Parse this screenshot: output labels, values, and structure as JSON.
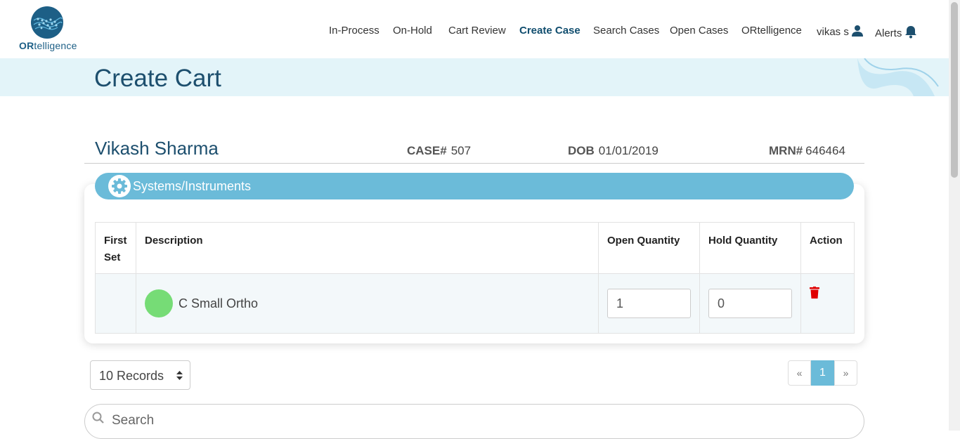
{
  "app": {
    "logo_text_bold": "OR",
    "logo_text_rest": "telligence"
  },
  "nav": {
    "items": [
      {
        "label": "In-Process"
      },
      {
        "label": "On-Hold"
      },
      {
        "label": "Cart Review"
      },
      {
        "label": "Create Case"
      },
      {
        "label": "Search Cases"
      },
      {
        "label": "Open Cases"
      },
      {
        "label": "ORtelligence"
      },
      {
        "label": "vikas s"
      },
      {
        "label": "Alerts"
      }
    ],
    "active": "Create Case"
  },
  "banner": {
    "title": "Create Cart"
  },
  "patient": {
    "name": "Vikash Sharma",
    "case_label": "CASE#",
    "case_value": "507",
    "dob_label": "DOB",
    "dob_value": "01/01/2019",
    "mrn_label": "MRN#",
    "mrn_value": "646464"
  },
  "section": {
    "title": "Systems/Instruments",
    "icon": "gear-icon"
  },
  "table": {
    "headers": {
      "first_set_line1": "First",
      "first_set_line2": "Set",
      "description": "Description",
      "open_quantity": "Open Quantity",
      "hold_quantity": "Hold Quantity",
      "action": "Action"
    },
    "rows": [
      {
        "first_set": "",
        "description": "C Small Ortho",
        "status_color": "#76dc76",
        "open_quantity": "1",
        "hold_quantity": "0",
        "action_icon": "trash-icon"
      }
    ]
  },
  "records_select": {
    "value": "10 Records"
  },
  "pagination": {
    "prev": "«",
    "current": "1",
    "next": "»"
  },
  "search": {
    "placeholder": "Search"
  },
  "colors": {
    "accent": "#6bbbd9",
    "brand": "#1d5f86",
    "banner_bg": "#e3f4f9",
    "delete": "#e00000"
  }
}
